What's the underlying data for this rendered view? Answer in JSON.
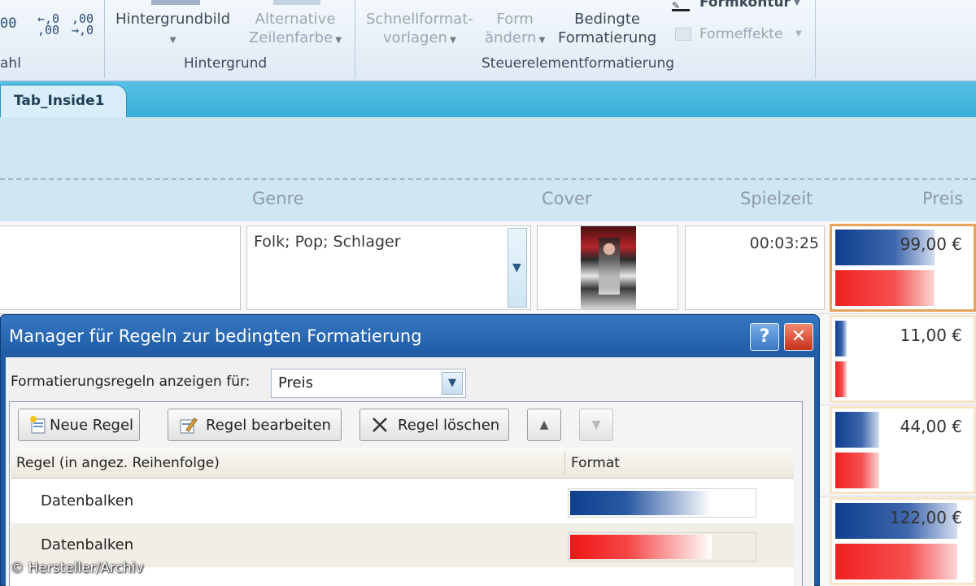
{
  "ribbon": {
    "number_group_label_partial": "ahl",
    "number_partial": "00",
    "inc_decimal_icon": "increase-decimals",
    "dec_decimal_icon": "decrease-decimals",
    "background_image_label": "Hintergrundbild",
    "alt_row_color_label_line1": "Alternative",
    "alt_row_color_label_line2": "Zeilenfarbe",
    "background_group_label": "Hintergrund",
    "quick_styles_line1": "Schnellformat-",
    "quick_styles_line2": "vorlagen",
    "change_shape_line1": "Form",
    "change_shape_line2": "ändern",
    "cond_format_line1": "Bedingte",
    "cond_format_line2": "Formatierung",
    "shape_outline_label": "Formkontur",
    "shape_effects_label": "Formeffekte",
    "control_format_group_label": "Steuerelementformatierung"
  },
  "tab": {
    "label": "Tab_Inside1"
  },
  "columns": {
    "genre": "Genre",
    "cover": "Cover",
    "duration": "Spielzeit",
    "price": "Preis"
  },
  "record": {
    "genre_value": "Folk; Pop; Schlager",
    "duration_value": "00:03:25"
  },
  "prices": [
    {
      "text": "99,00 €",
      "fraction": 0.81
    },
    {
      "text": "11,00 €",
      "fraction": 0.09
    },
    {
      "text": "44,00 €",
      "fraction": 0.36
    },
    {
      "text": "122,00 €",
      "fraction": 1.0
    }
  ],
  "dialog": {
    "title": "Manager für Regeln zur bedingten Formatierung",
    "help_glyph": "?",
    "close_glyph": "✕",
    "show_rules_label": "Formatierungsregeln anzeigen für:",
    "show_rules_value": "Preis",
    "new_rule": "Neue Regel",
    "edit_rule": "Regel bearbeiten",
    "delete_rule": "Regel löschen",
    "col_rule": "Regel (in angez. Reihenfolge)",
    "col_format": "Format",
    "rules": [
      {
        "name": "Datenbalken",
        "format_color": "#0e3e8e"
      },
      {
        "name": "Datenbalken",
        "format_color": "#f01515"
      }
    ]
  },
  "credit": "© Hersteller/Archiv"
}
